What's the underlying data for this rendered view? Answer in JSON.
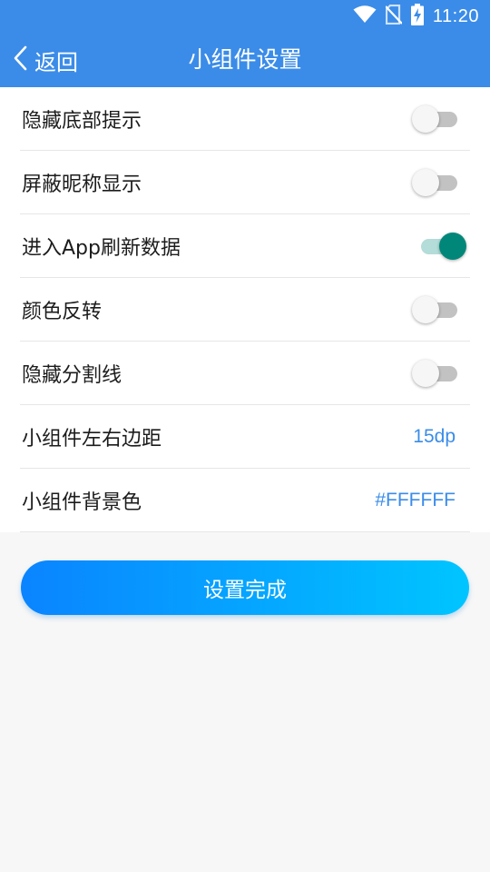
{
  "status_bar": {
    "time": "11:20",
    "icons": [
      "wifi-icon",
      "no-sim-icon",
      "battery-charging-icon"
    ]
  },
  "header": {
    "back_label": "返回",
    "title": "小组件设置"
  },
  "settings": [
    {
      "label": "隐藏底部提示",
      "type": "toggle",
      "on": false
    },
    {
      "label": "屏蔽昵称显示",
      "type": "toggle",
      "on": false
    },
    {
      "label": "进入App刷新数据",
      "type": "toggle",
      "on": true
    },
    {
      "label": "颜色反转",
      "type": "toggle",
      "on": false
    },
    {
      "label": "隐藏分割线",
      "type": "toggle",
      "on": false
    },
    {
      "label": "小组件左右边距",
      "type": "value",
      "value": "15dp"
    },
    {
      "label": "小组件背景色",
      "type": "value",
      "value": "#FFFFFF"
    }
  ],
  "confirm_label": "设置完成",
  "colors": {
    "header_bg": "#3b8ce8",
    "accent": "#3b8ce8",
    "toggle_on": "#00877a",
    "button_gradient_start": "#0a84ff",
    "button_gradient_end": "#00c5ff"
  }
}
